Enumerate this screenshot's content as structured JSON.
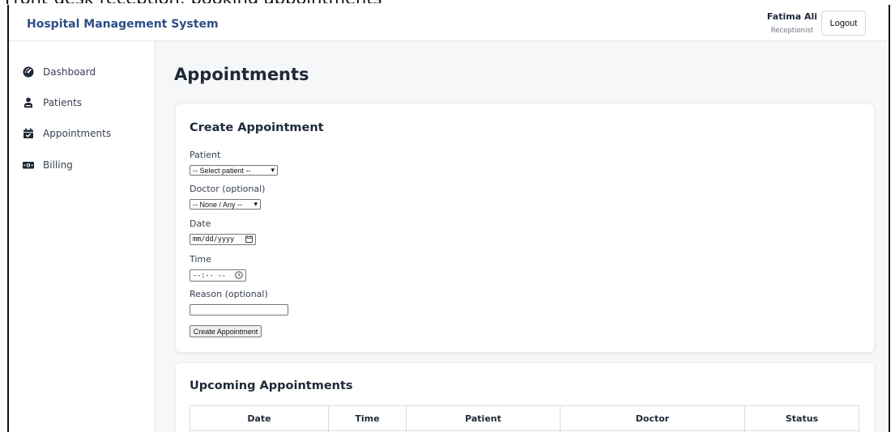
{
  "caption": "Front-desk reception: booking appointments",
  "header": {
    "brand": "Hospital Management System",
    "user_name": "Fatima Ali",
    "user_role": "Receptionist",
    "logout_label": "Logout"
  },
  "sidebar": {
    "items": [
      {
        "label": "Dashboard",
        "icon": "gauge-icon"
      },
      {
        "label": "Patients",
        "icon": "patient-icon"
      },
      {
        "label": "Appointments",
        "icon": "calendar-check-icon"
      },
      {
        "label": "Billing",
        "icon": "money-bill-icon"
      }
    ]
  },
  "main": {
    "page_title": "Appointments",
    "create": {
      "title": "Create Appointment",
      "patient_label": "Patient",
      "patient_selected": "-- Select patient --",
      "doctor_label": "Doctor (optional)",
      "doctor_selected": "-- None / Any --",
      "date_label": "Date",
      "date_placeholder": "mm/dd/yyyy",
      "time_label": "Time",
      "time_placeholder": "--:-- --",
      "reason_label": "Reason (optional)",
      "reason_value": "",
      "submit_label": "Create Appointment"
    },
    "upcoming": {
      "title": "Upcoming Appointments",
      "columns": [
        "Date",
        "Time",
        "Patient",
        "Doctor",
        "Status"
      ]
    }
  },
  "colors": {
    "brand": "#2e4d85",
    "background": "#f6f7f9"
  }
}
